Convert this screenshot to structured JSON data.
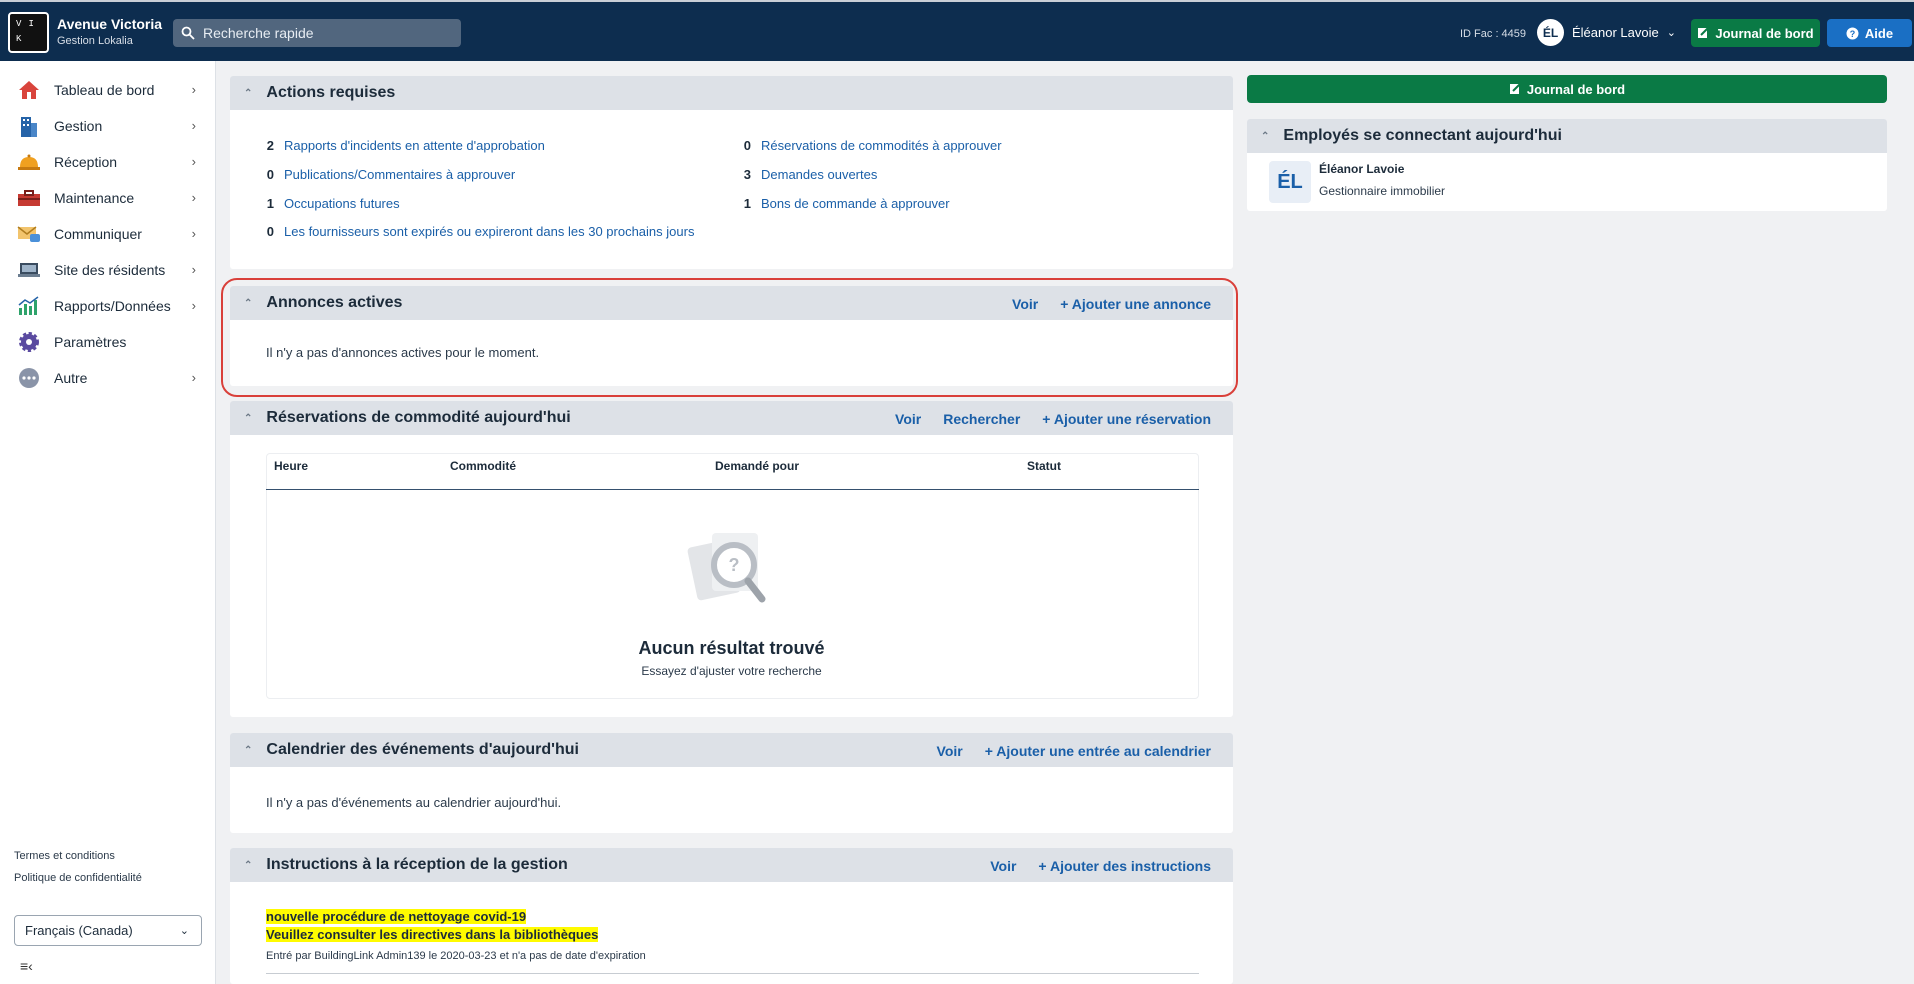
{
  "app": {
    "logo_letters": [
      "V",
      "I",
      "K",
      ""
    ],
    "building_name": "Avenue Victoria",
    "company_name": "Gestion Lokalia",
    "search_placeholder": "Recherche rapide",
    "id_fac": "ID Fac : 4459",
    "user_initials": "ÉL",
    "user_name": "Éléanor Lavoie",
    "journal_label": "Journal de bord",
    "aide_label": "Aide"
  },
  "sidebar": {
    "items": [
      {
        "label": "Tableau de bord",
        "icon": "house-icon"
      },
      {
        "label": "Gestion",
        "icon": "building-icon"
      },
      {
        "label": "Réception",
        "icon": "bell-icon"
      },
      {
        "label": "Maintenance",
        "icon": "toolbox-icon"
      },
      {
        "label": "Communiquer",
        "icon": "envelope-icon"
      },
      {
        "label": "Site des résidents",
        "icon": "laptop-icon"
      },
      {
        "label": "Rapports/Données",
        "icon": "chart-icon"
      },
      {
        "label": "Paramètres",
        "icon": "gear-icon"
      },
      {
        "label": "Autre",
        "icon": "more-icon"
      }
    ],
    "terms": "Termes et conditions",
    "privacy": "Politique de confidentialité",
    "language": "Français (Canada)"
  },
  "actions": {
    "title": "Actions requises",
    "left": [
      {
        "count": "2",
        "label": "Rapports d'incidents en attente d'approbation"
      },
      {
        "count": "0",
        "label": "Publications/Commentaires à approuver"
      },
      {
        "count": "1",
        "label": "Occupations futures"
      },
      {
        "count": "0",
        "label": "Les fournisseurs sont expirés ou expireront dans les 30 prochains jours"
      }
    ],
    "right": [
      {
        "count": "0",
        "label": "Réservations de commodités à approuver"
      },
      {
        "count": "3",
        "label": "Demandes ouvertes"
      },
      {
        "count": "1",
        "label": "Bons de commande à approuver"
      }
    ]
  },
  "announcements": {
    "title": "Annonces actives",
    "view": "Voir",
    "add": "+ Ajouter une annonce",
    "empty": "Il n'y a pas d'annonces actives pour le moment."
  },
  "reservations": {
    "title": "Réservations de commodité aujourd'hui",
    "view": "Voir",
    "search": "Rechercher",
    "add": "+ Ajouter une réservation",
    "columns": [
      "Heure",
      "Commodité",
      "Demandé pour",
      "Statut"
    ],
    "empty_title": "Aucun résultat trouvé",
    "empty_sub": "Essayez d'ajuster votre recherche"
  },
  "calendar": {
    "title": "Calendrier des événements d'aujourd'hui",
    "view": "Voir",
    "add": "+ Ajouter une entrée au calendrier",
    "empty": "Il n'y a pas d'événements au calendrier aujourd'hui."
  },
  "instructions": {
    "title": "Instructions à la réception de la gestion",
    "view": "Voir",
    "add": "+ Ajouter des instructions",
    "line1": "nouvelle procédure de nettoyage covid-19",
    "line2": "Veuillez consulter les directives dans la bibliothèques",
    "meta": "Entré par BuildingLink Admin139 le 2020-03-23 et n'a pas de date d'expiration"
  },
  "right_panel": {
    "journal_label": "Journal de bord",
    "employees_title": "Employés se connectant aujourd'hui",
    "employee_initials": "ÉL",
    "employee_name": "Éléanor Lavoie",
    "employee_role": "Gestionnaire immobilier"
  }
}
